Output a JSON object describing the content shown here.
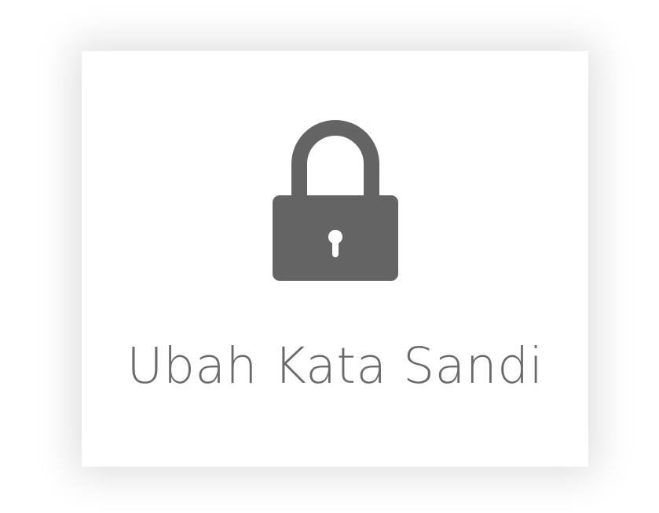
{
  "card": {
    "icon": "lock-icon",
    "label": "Ubah Kata Sandi"
  },
  "colors": {
    "background": "#ffffff",
    "icon": "#646464",
    "text": "#6a6a6a"
  }
}
